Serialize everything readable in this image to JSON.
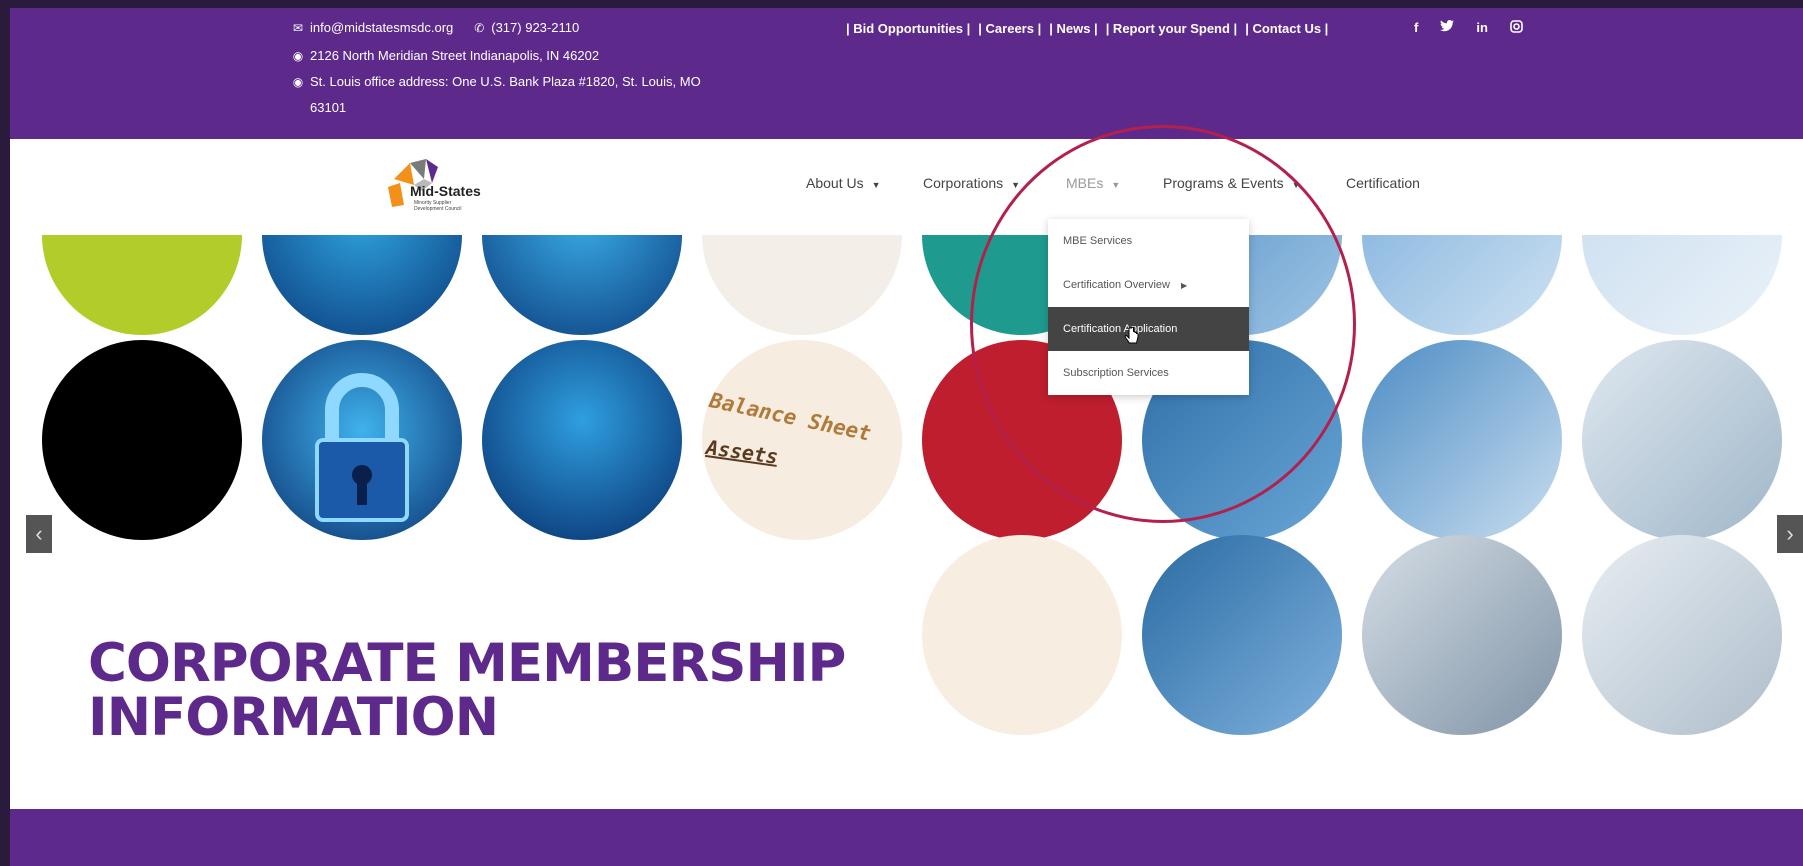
{
  "topbar": {
    "email": "info@midstatesmsdc.org",
    "phone": "(317) 923-2110",
    "address1": "2126 North Meridian Street Indianapolis, IN 46202",
    "address2": "St. Louis office address: One U.S. Bank Plaza #1820, St. Louis, MO",
    "address2_cont": "63101",
    "links": [
      "| Bid Opportunities |",
      "| Careers |",
      "| News |",
      "| Report your Spend |",
      "| Contact Us |"
    ],
    "social": [
      "f",
      "♥",
      "in",
      "◎"
    ],
    "social_icons": [
      "facebook-icon",
      "twitter-icon",
      "linkedin-icon",
      "instagram-icon"
    ]
  },
  "logo": {
    "title": "Mid-States",
    "sub1": "Minority Supplier",
    "sub2": "Development Council"
  },
  "mainnav": {
    "about": "About Us",
    "corporations": "Corporations",
    "mbes": "MBEs",
    "programs": "Programs & Events",
    "certification": "Certification"
  },
  "dropdown": {
    "items": [
      "MBE Services",
      "Certification Overview",
      "Certification Application",
      "Subscription Services"
    ],
    "active_index": 2
  },
  "hero": {
    "title_line1": "CORPORATE MEMBERSHIP",
    "title_line2": "INFORMATION",
    "prev": "‹",
    "next": "›"
  },
  "colors": {
    "brand_purple": "#5d2a8c",
    "annotation": "#b4204c",
    "dropdown_active": "#444444"
  }
}
